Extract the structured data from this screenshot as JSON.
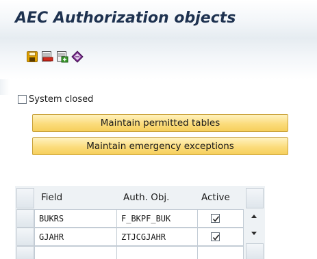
{
  "window": {
    "title": "AEC Authorization objects"
  },
  "toolbar": {
    "buttons": [
      {
        "icon": "save-icon"
      },
      {
        "icon": "delete-row-icon"
      },
      {
        "icon": "add-row-icon"
      },
      {
        "icon": "documentation-icon"
      }
    ]
  },
  "form": {
    "system_closed": {
      "label": "System closed",
      "checked": false
    },
    "maintain_tables_label": "Maintain permitted tables",
    "maintain_exceptions_label": "Maintain emergency exceptions"
  },
  "table": {
    "columns": [
      "Field",
      "Auth. Obj.",
      "Active"
    ],
    "rows": [
      {
        "field": "BUKRS",
        "auth_obj": "F_BKPF_BUK",
        "active": true
      },
      {
        "field": "GJAHR",
        "auth_obj": "ZTJCGJAHR",
        "active": true
      }
    ]
  },
  "colors": {
    "title": "#1e3250",
    "button_fill": "#fbdc7c",
    "button_border": "#c9a23a",
    "save_icon": "#e0a200",
    "table_bg": "#eef2f5"
  }
}
